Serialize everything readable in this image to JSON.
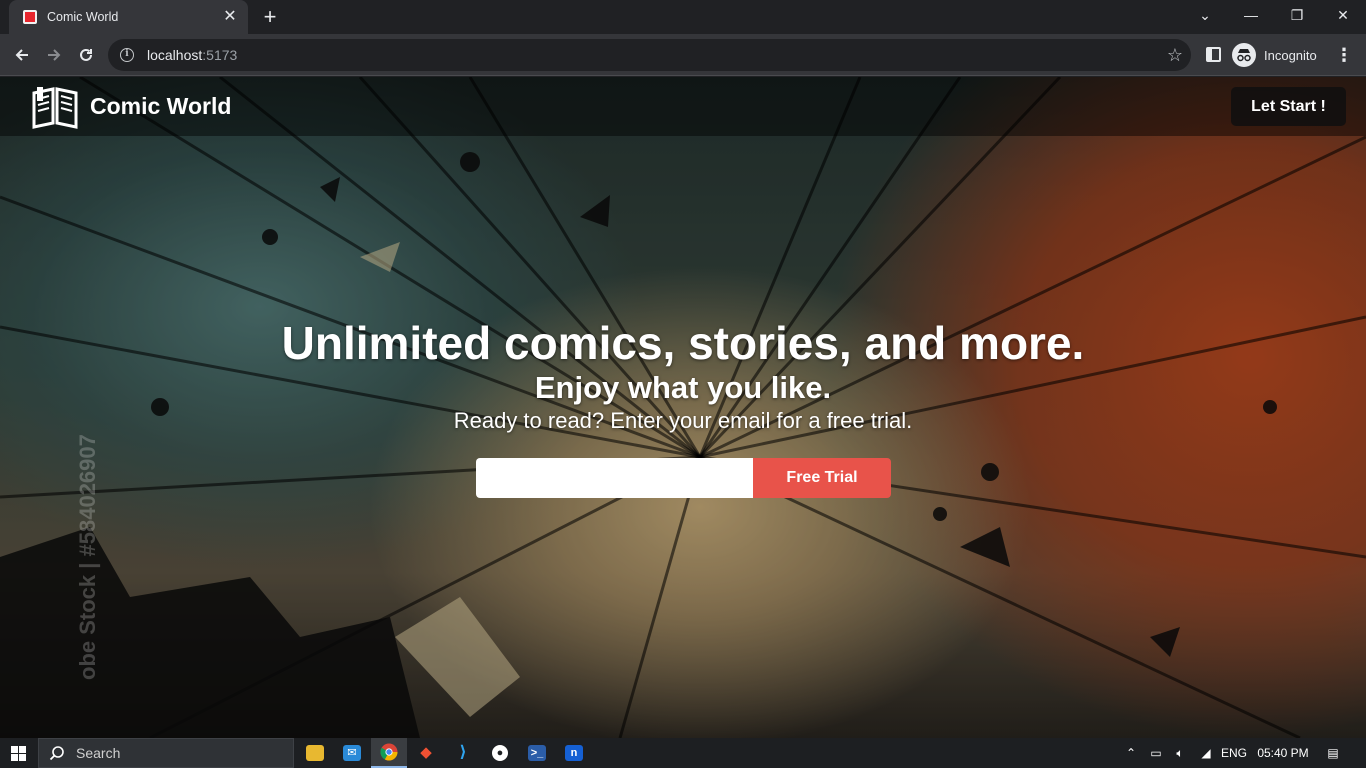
{
  "browser": {
    "tab_title": "Comic World",
    "tab_close": "✕",
    "new_tab": "+",
    "url_host": "localhost",
    "url_port": ":5173",
    "profile_label": "Incognito",
    "window_controls": {
      "dropdown": "⌄",
      "minimize": "—",
      "restore": "❐",
      "close": "✕"
    },
    "icons": [
      "back-arrow-icon",
      "forward-arrow-icon",
      "reload-icon",
      "info-icon",
      "bookmark-star-icon",
      "side-panel-icon",
      "incognito-icon",
      "kebab-menu-icon"
    ]
  },
  "site": {
    "title": "Comic World",
    "cta_label": "Let Start !",
    "logo_icon": "open-book-icon"
  },
  "hero": {
    "title": "Unlimited comics, stories, and more.",
    "subtitle": "Enjoy what you like.",
    "text": "Ready to read? Enter your email for a free trial.",
    "email_value": "",
    "button_label": "Free Trial",
    "button_color": "#e8534a",
    "watermark": "obe Stock | #584026907"
  },
  "taskbar": {
    "search_label": "Search",
    "language": "ENG",
    "time": "05:40 PM",
    "apps": [
      "file-explorer-icon",
      "mail-icon",
      "chrome-icon",
      "git-icon",
      "vscode-icon",
      "github-icon",
      "powershell-icon",
      "notion-icon"
    ]
  }
}
